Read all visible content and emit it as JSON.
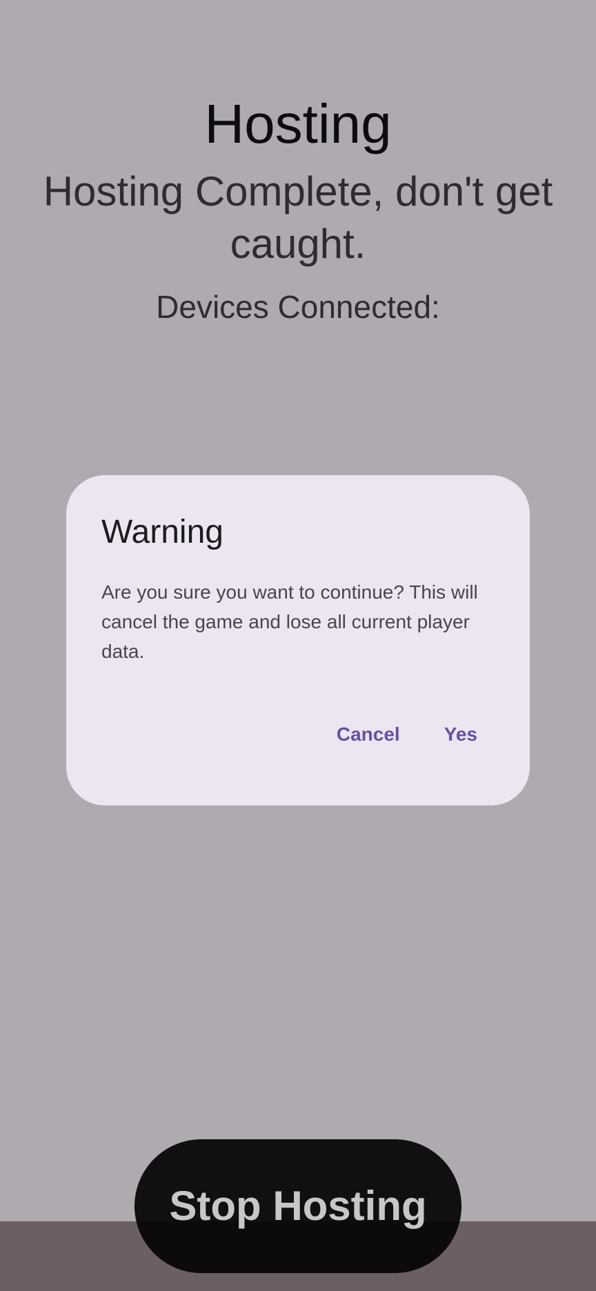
{
  "screen": {
    "title": "Hosting",
    "subtitle": "Hosting Complete, don't get caught.",
    "devices_label": "Devices Connected:",
    "stop_button_label": "Stop Hosting"
  },
  "dialog": {
    "title": "Warning",
    "message": "Are you sure you want to continue? This will cancel the game and lose all current player data.",
    "cancel_label": "Cancel",
    "confirm_label": "Yes"
  },
  "colors": {
    "scrim": "#aeaaaf",
    "dialog_surface": "#ece6f0",
    "accent": "#6750a4",
    "nav_bar": "#6b5f65"
  }
}
